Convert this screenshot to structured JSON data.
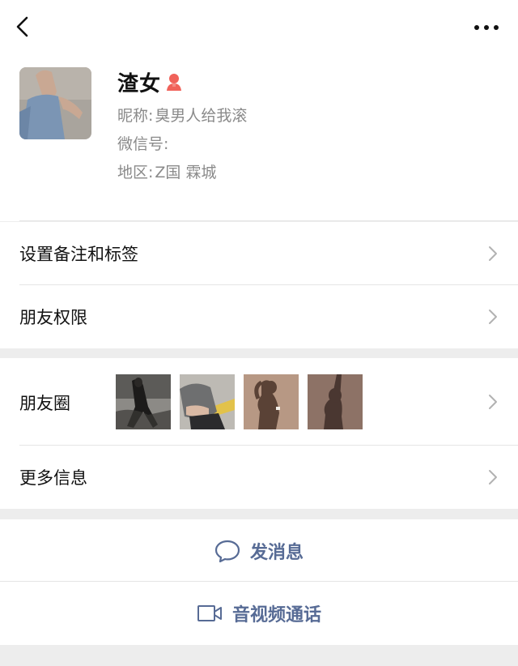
{
  "header": {
    "back_icon": "chevron-left-icon",
    "more_icon": "ellipsis-icon"
  },
  "profile": {
    "display_name": "渣女",
    "gender_icon": "female-icon",
    "gender_color": "#f0625a",
    "nickname_label": "昵称:",
    "nickname_value": "臭男人给我滚",
    "wechat_id_label": "微信号:",
    "wechat_id_value": "",
    "region_label": "地区:",
    "region_value": "Z国 霖城"
  },
  "menu": {
    "remarks_tags": "设置备注和标签",
    "friend_permissions": "朋友权限",
    "moments": "朋友圈",
    "more_info": "更多信息"
  },
  "actions": {
    "send_message": "发消息",
    "send_message_icon": "chat-bubble-icon",
    "video_call": "音视频通话",
    "video_call_icon": "video-camera-icon",
    "accent_color": "#576b95"
  }
}
